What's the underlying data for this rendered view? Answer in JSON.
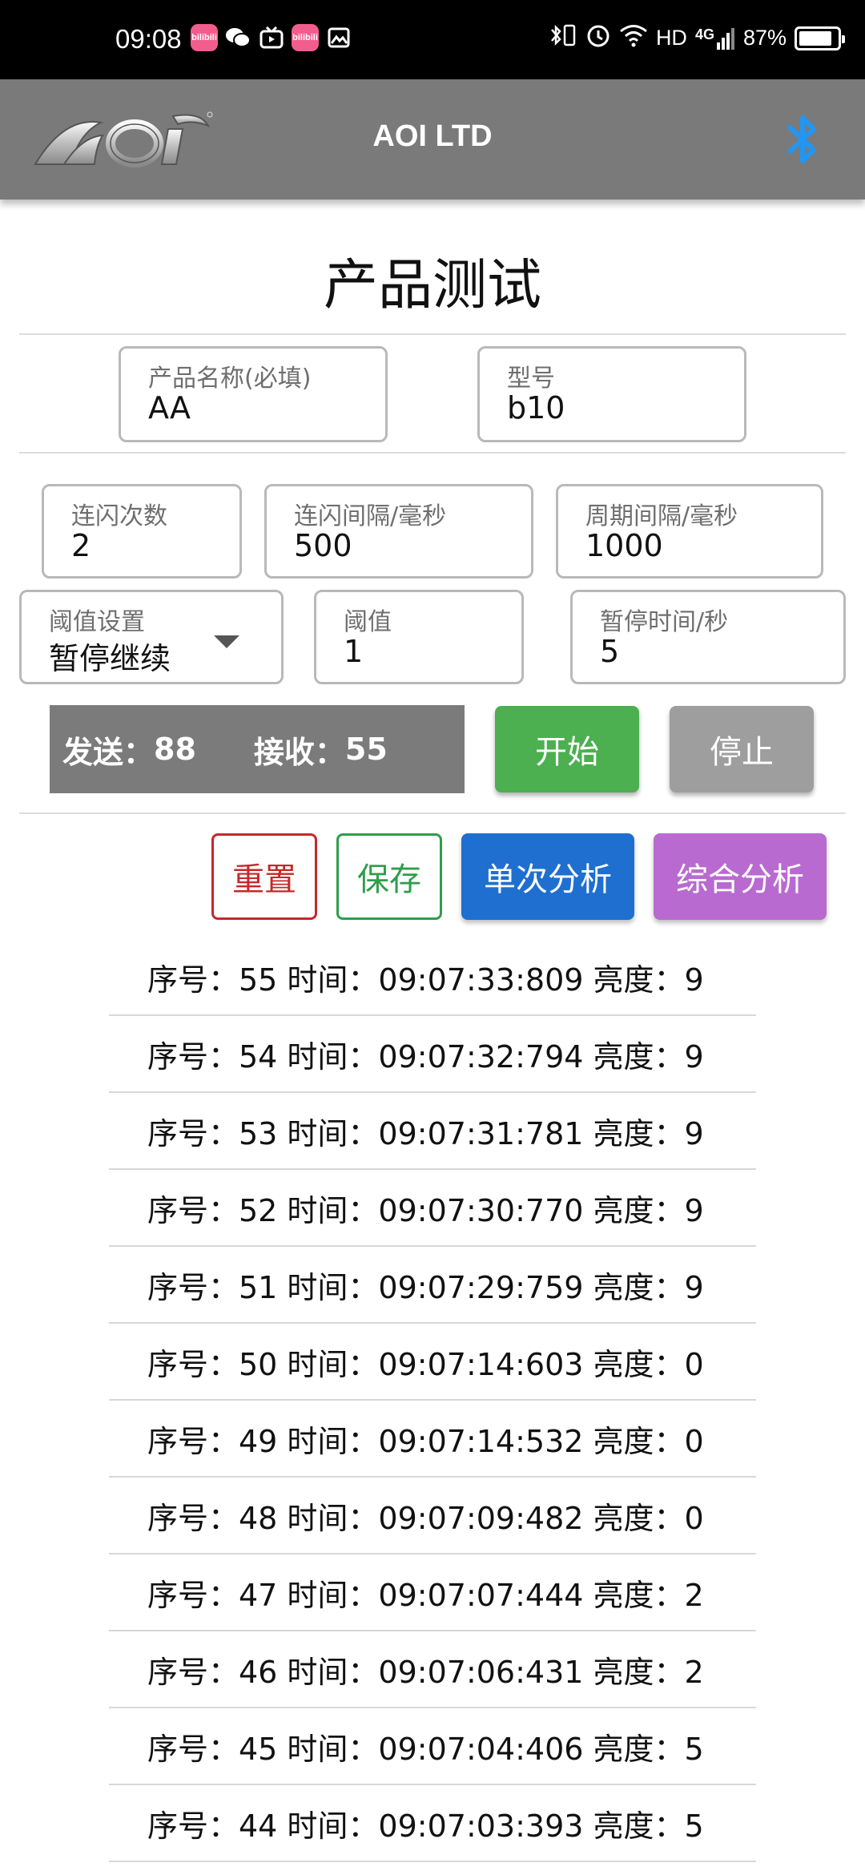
{
  "status_bar": {
    "time": "09:08",
    "left_icons": [
      "bilibili-icon",
      "wechat-icon",
      "tv-icon",
      "bilibili-icon",
      "gallery-icon"
    ],
    "badge_text": "bilibili",
    "network": "HD",
    "signal": "4G",
    "battery": "87%",
    "battery_level": 0.87
  },
  "app_bar": {
    "title": "AOI LTD",
    "logo_text": "AOI",
    "bluetooth_color": "#2196f3"
  },
  "page": {
    "title": "产品测试"
  },
  "product": {
    "name_label": "产品名称(必填)",
    "name_value": "AA",
    "model_label": "型号",
    "model_value": "b10"
  },
  "params": {
    "flash_count_label": "连闪次数",
    "flash_count_value": "2",
    "flash_interval_label": "连闪间隔/毫秒",
    "flash_interval_value": "500",
    "cycle_interval_label": "周期间隔/毫秒",
    "cycle_interval_value": "1000",
    "threshold_mode_label": "阈值设置",
    "threshold_mode_value": "暂停继续",
    "threshold_label": "阈值",
    "threshold_value": "1",
    "pause_time_label": "暂停时间/秒",
    "pause_time_value": "5"
  },
  "counters": {
    "send_label": "发送：",
    "send_value": "88",
    "receive_label": "接收：",
    "receive_value": "55"
  },
  "buttons": {
    "start": "开始",
    "stop": "停止",
    "reset": "重置",
    "save": "保存",
    "single_analysis": "单次分析",
    "overall_analysis": "综合分析"
  },
  "records": [
    "序号：55 时间：09:07:33:809 亮度：9",
    "序号：54 时间：09:07:32:794 亮度：9",
    "序号：53 时间：09:07:31:781 亮度：9",
    "序号：52 时间：09:07:30:770 亮度：9",
    "序号：51 时间：09:07:29:759 亮度：9",
    "序号：50 时间：09:07:14:603 亮度：0",
    "序号：49 时间：09:07:14:532 亮度：0",
    "序号：48 时间：09:07:09:482 亮度：0",
    "序号：47 时间：09:07:07:444 亮度：2",
    "序号：46 时间：09:07:06:431 亮度：2",
    "序号：45 时间：09:07:04:406 亮度：5",
    "序号：44 时间：09:07:03:393 亮度：5"
  ]
}
